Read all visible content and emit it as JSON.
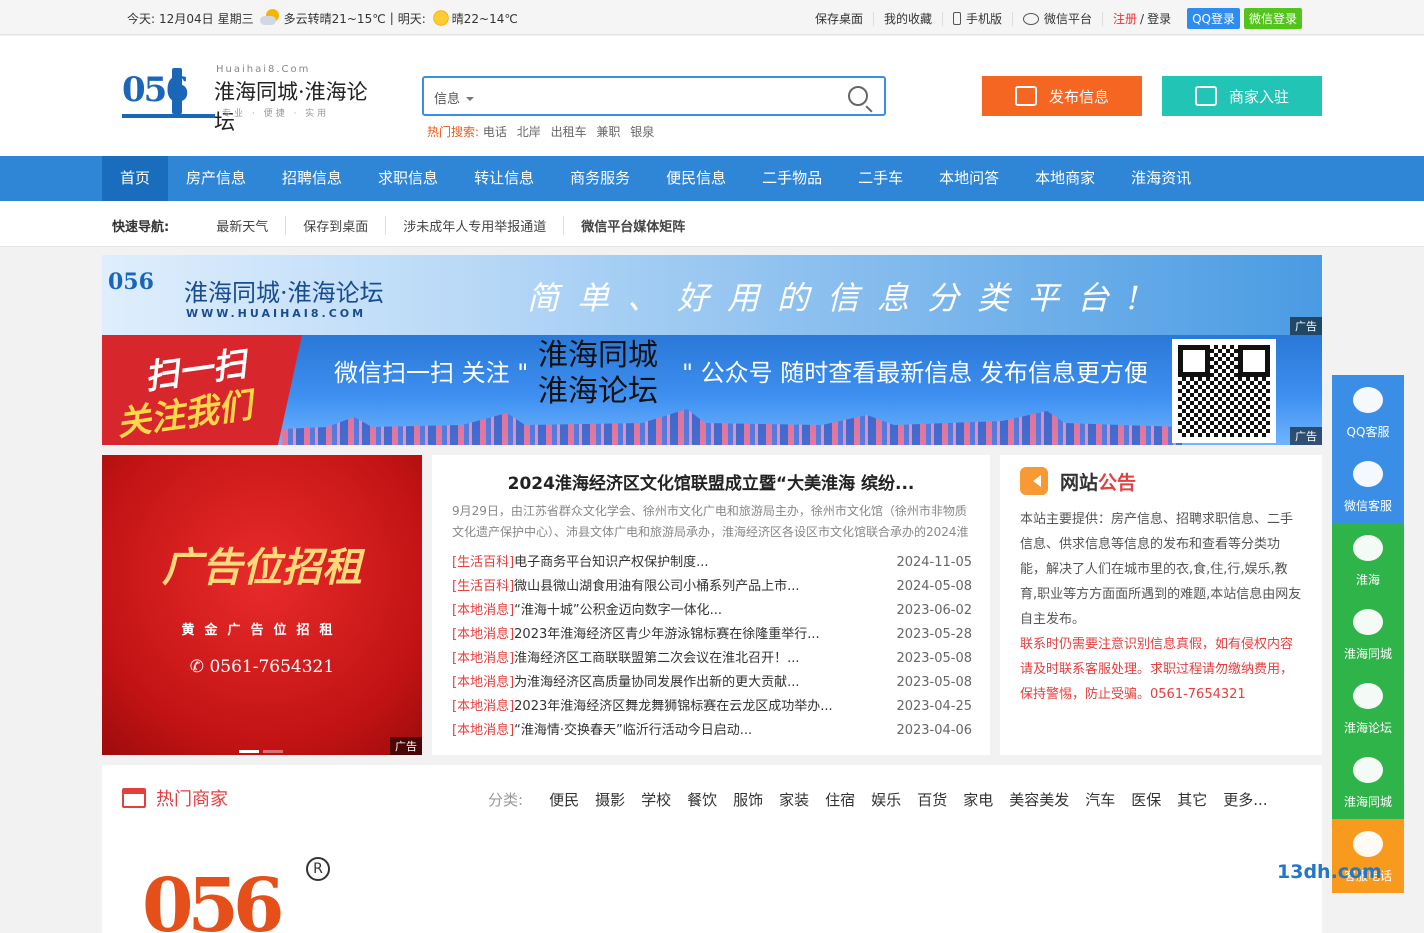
{
  "topbar": {
    "today_label": "今天:",
    "date": "12月04日",
    "weekday": "星期三",
    "today_weather": "多云转晴21~15℃",
    "sep": "|",
    "tomorrow_label": "明天:",
    "tomorrow_weather": "晴22~14℃",
    "links": [
      "保存桌面",
      "我的收藏",
      "手机版",
      "微信平台"
    ],
    "register": "注册",
    "slash": "/",
    "login": "登录",
    "qq_login": "QQ登录",
    "wx_login": "微信登录"
  },
  "header": {
    "logo_num": "056",
    "logo_domain": "Huaihai8.Com",
    "logo_name": "淮海同城·淮海论坛",
    "logo_slogan": "专业 · 便捷 · 实用",
    "search_select": "信息",
    "hot_label": "热门搜索:",
    "hot_terms": [
      "电话",
      "北岸",
      "出租车",
      "兼职",
      "银泉"
    ],
    "publish_btn": "发布信息",
    "merchant_btn": "商家入驻"
  },
  "nav": {
    "items": [
      "首页",
      "房产信息",
      "招聘信息",
      "求职信息",
      "转让信息",
      "商务服务",
      "便民信息",
      "二手物品",
      "二手车",
      "本地问答",
      "本地商家",
      "淮海资讯"
    ]
  },
  "quick": {
    "label": "快速导航:",
    "items": [
      "最新天气",
      "保存到桌面",
      "涉未成年人专用举报通道",
      "微信平台媒体矩阵"
    ]
  },
  "banner1": {
    "logo": "056",
    "name": "淮海同城·淮海论坛",
    "url": "WWW.HUAIHAI8.COM",
    "slogan": "简单、好用的信息分类平台!",
    "ad": "广告"
  },
  "banner2": {
    "scan1": "扫一扫",
    "scan2": "关注我们",
    "text1": "微信扫一扫 关注 \"",
    "name1": "淮海同城",
    "name2": "淮海论坛",
    "text2": "\" 公众号 随时查看最新信息 发布信息更方便",
    "ad": "广告"
  },
  "promo": {
    "title": "广告位招租",
    "sub": "黄金广告位招租",
    "phone": "0561-7654321",
    "ad": "广告"
  },
  "news": {
    "headline": "2024淮海经济区文化馆联盟成立暨“大美淮海 缤纷...",
    "summary": "9月29日，由江苏省群众文化学会、徐州市文化广电和旅游局主办，徐州市文化馆（徐州市非物质文化遗产保护中心）、沛县文体广电和旅游局承办，淮海经济区各设区市文化馆联合承办的2024淮",
    "items": [
      {
        "cat": "[生活百科]",
        "title": "电子商务平台知识产权保护制度...",
        "date": "2024-11-05"
      },
      {
        "cat": "[生活百科]",
        "title": "微山县微山湖食用油有限公司小桶系列产品上市...",
        "date": "2024-05-08"
      },
      {
        "cat": "[本地消息]",
        "title": "“淮海十城”公积金迈向数字一体化...",
        "date": "2023-06-02"
      },
      {
        "cat": "[本地消息]",
        "title": "2023年淮海经济区青少年游泳锦标赛在徐隆重举行...",
        "date": "2023-05-28"
      },
      {
        "cat": "[本地消息]",
        "title": "淮海经济区工商联联盟第二次会议在淮北召开！...",
        "date": "2023-05-08"
      },
      {
        "cat": "[本地消息]",
        "title": "为淮海经济区高质量协同发展作出新的更大贡献...",
        "date": "2023-05-08"
      },
      {
        "cat": "[本地消息]",
        "title": "2023年淮海经济区舞龙舞狮锦标赛在云龙区成功举办...",
        "date": "2023-04-25"
      },
      {
        "cat": "[本地消息]",
        "title": "“淮海情·交换春天”临沂行活动今日启动...",
        "date": "2023-04-06"
      }
    ]
  },
  "notice": {
    "title_a": "网站",
    "title_b": "公告",
    "p1": "本站主要提供：房产信息、招聘求职信息、二手信息、供求信息等信息的发布和查看等分类功能，解决了人们在城市里的衣,食,住,行,娱乐,教育,职业等方方面面所遇到的难题,本站信息由网友自主发布。",
    "p2": "联系时仍需要注意识别信息真假，如有侵权内容请及时联系客服处理。求职过程请勿缴纳费用，保持警惕，防止受骗。0561-7654321"
  },
  "hot_merchants": {
    "title": "热门商家",
    "cat_label": "分类:",
    "cats": [
      "便民",
      "摄影",
      "学校",
      "餐饮",
      "服饰",
      "家装",
      "住宿",
      "娱乐",
      "百货",
      "家电",
      "美容美发",
      "汽车",
      "医保",
      "其它",
      "更多..."
    ],
    "logo_num": "056",
    "reg": "R"
  },
  "side": {
    "buttons": [
      {
        "label": "QQ客服",
        "color": "#3a8ee6"
      },
      {
        "label": "微信客服",
        "color": "#3a8ee6"
      },
      {
        "label": "淮海",
        "color": "#2fb44a"
      },
      {
        "label": "淮海同城",
        "color": "#2fb44a"
      },
      {
        "label": "淮海论坛",
        "color": "#2fb44a"
      },
      {
        "label": "淮海同城",
        "color": "#2fb44a"
      },
      {
        "label": "客服电话",
        "color": "#f79a1e"
      }
    ]
  },
  "watermark": "13dh.com"
}
